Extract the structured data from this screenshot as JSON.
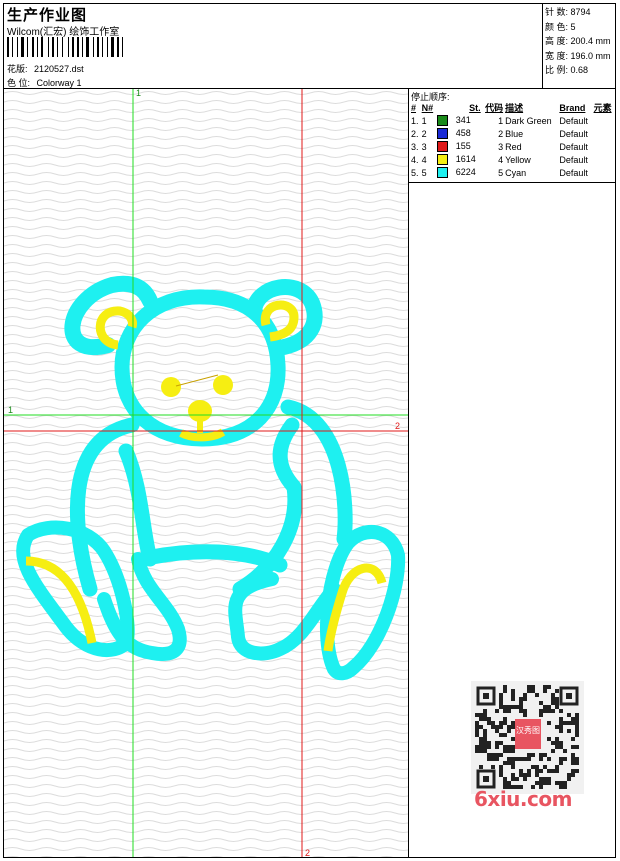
{
  "header": {
    "title": "生产作业图",
    "studio": "Wilcom(汇宏) 绘饰工作室",
    "design_label": "花版:",
    "design_value": "2120527.dst",
    "colorway_label": "色 位:",
    "colorway_value": "Colorway 1"
  },
  "stats": [
    {
      "label": "针 数:",
      "value": "8794"
    },
    {
      "label": "颜 色:",
      "value": "5"
    },
    {
      "label": "高 度:",
      "value": "200.4 mm"
    },
    {
      "label": "宽 度:",
      "value": "196.0 mm"
    },
    {
      "label": "比 例:",
      "value": "0.68"
    }
  ],
  "stop_sequence": {
    "title": "停止顺序:",
    "columns": [
      "#",
      "N#",
      "St.",
      "代码",
      "描述",
      "Brand",
      "元素"
    ],
    "rows": [
      {
        "num": "1.",
        "n": "1",
        "color": "#1a8a1a",
        "stitches": "341",
        "code": "1",
        "desc": "Dark Green",
        "brand": "Default"
      },
      {
        "num": "2.",
        "n": "2",
        "color": "#1a2ad6",
        "stitches": "458",
        "code": "2",
        "desc": "Blue",
        "brand": "Default"
      },
      {
        "num": "3.",
        "n": "3",
        "color": "#e01818",
        "stitches": "155",
        "code": "3",
        "desc": "Red",
        "brand": "Default"
      },
      {
        "num": "4.",
        "n": "4",
        "color": "#f6ee12",
        "stitches": "1614",
        "code": "4",
        "desc": "Yellow",
        "brand": "Default"
      },
      {
        "num": "5.",
        "n": "5",
        "color": "#1ef0f0",
        "stitches": "6224",
        "code": "5",
        "desc": "Cyan",
        "brand": "Default"
      }
    ]
  },
  "guides": {
    "green_h": "1",
    "green_v": "1",
    "red_h": "2",
    "red_v": "2"
  },
  "colors": {
    "cyan": "#1ef0f0",
    "yellow": "#f6ee12",
    "green_guide": "#22dd22",
    "red_guide": "#e01818"
  },
  "watermark": "6xiu.com",
  "qr_seal": "汉秀图"
}
